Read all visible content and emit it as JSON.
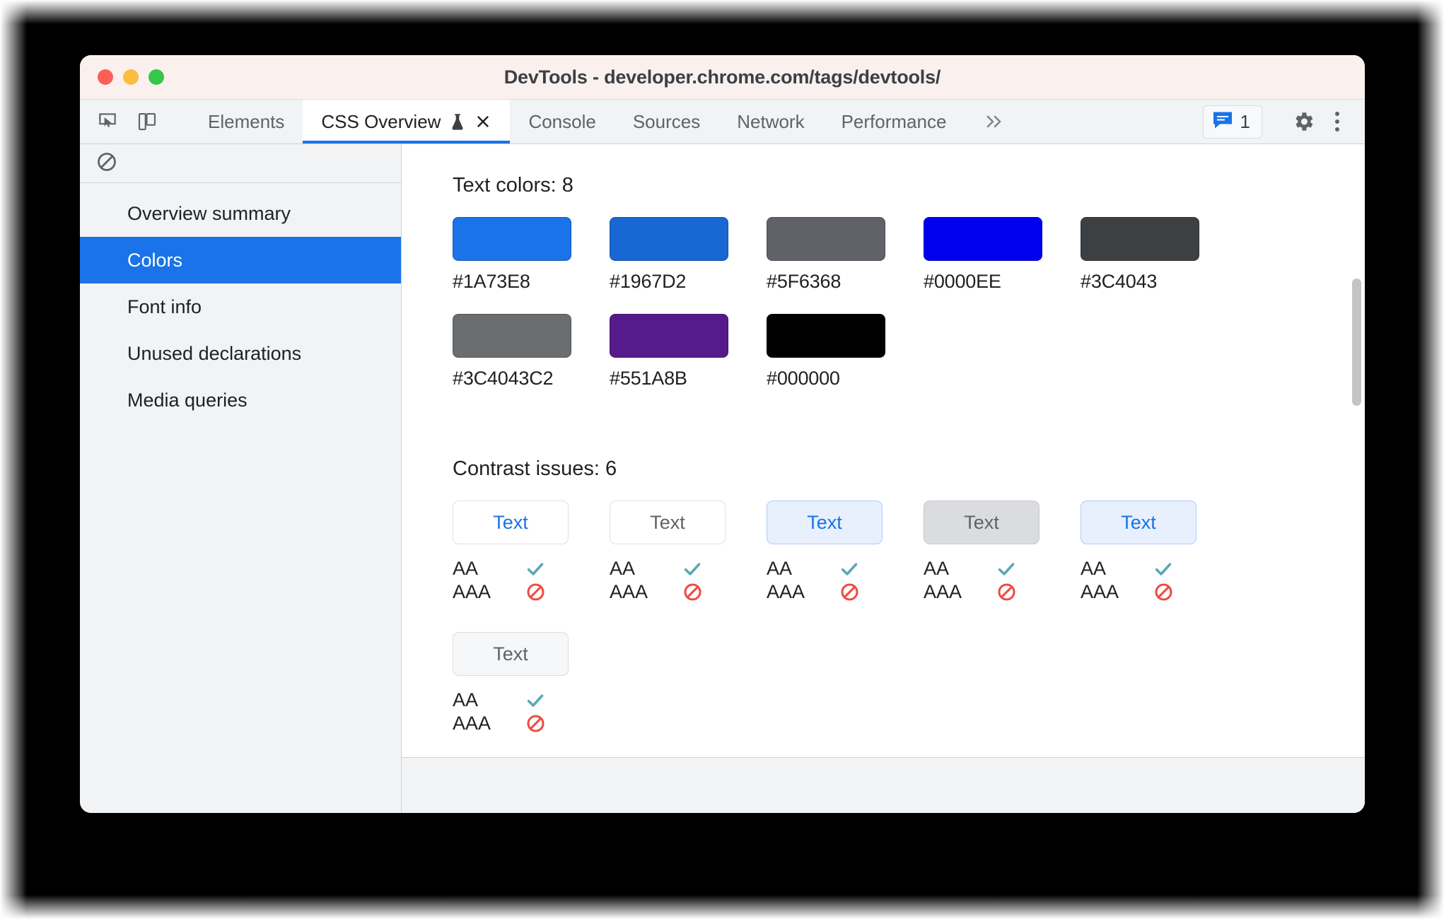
{
  "window": {
    "title": "DevTools - developer.chrome.com/tags/devtools/",
    "traffic_lights": [
      "close",
      "minimize",
      "zoom"
    ]
  },
  "tabstrip": {
    "inspect_icon": "inspect-cursor-icon",
    "device_icon": "device-toolbar-icon",
    "tabs": [
      {
        "label": "Elements",
        "active": false
      },
      {
        "label": "CSS Overview",
        "active": true,
        "experiment": true,
        "closable": true
      },
      {
        "label": "Console",
        "active": false
      },
      {
        "label": "Sources",
        "active": false
      },
      {
        "label": "Network",
        "active": false
      },
      {
        "label": "Performance",
        "active": false
      }
    ],
    "more_tabs_label": "»",
    "message_count": "1",
    "settings_icon": "gear-icon",
    "menu_icon": "kebab-menu-icon"
  },
  "sidebar": {
    "toolbar_icon": "clear-overview-icon",
    "items": [
      {
        "label": "Overview summary",
        "selected": false
      },
      {
        "label": "Colors",
        "selected": true
      },
      {
        "label": "Font info",
        "selected": false
      },
      {
        "label": "Unused declarations",
        "selected": false
      },
      {
        "label": "Media queries",
        "selected": false
      }
    ]
  },
  "content": {
    "text_colors": {
      "heading": "Text colors: 8",
      "swatches": [
        {
          "hex": "#1A73E8",
          "label": "#1A73E8"
        },
        {
          "hex": "#1967D2",
          "label": "#1967D2"
        },
        {
          "hex": "#5F6368",
          "label": "#5F6368"
        },
        {
          "hex": "#0000EE",
          "label": "#0000EE"
        },
        {
          "hex": "#3C4043",
          "label": "#3C4043"
        },
        {
          "hex": "#3C4043C2",
          "label": "#3C4043C2"
        },
        {
          "hex": "#551A8B",
          "label": "#551A8B"
        },
        {
          "hex": "#000000",
          "label": "#000000"
        }
      ]
    },
    "contrast_issues": {
      "heading": "Contrast issues: 6",
      "aa_label": "AA",
      "aaa_label": "AAA",
      "pass_icon": "checkmark-icon",
      "fail_icon": "no-entry-icon",
      "pass_color": "#5BA8B8",
      "fail_color": "#EE4B42",
      "cards": [
        {
          "text": "Text",
          "text_color": "#1A73E8",
          "bg": "#FFFFFF",
          "border": "#E0E0E0",
          "aa": "pass",
          "aaa": "fail"
        },
        {
          "text": "Text",
          "text_color": "#5F6368",
          "bg": "#FFFFFF",
          "border": "#E0E0E0",
          "aa": "pass",
          "aaa": "fail"
        },
        {
          "text": "Text",
          "text_color": "#1A73E8",
          "bg": "#E8F0FE",
          "border": "#AECBFA",
          "aa": "pass",
          "aaa": "fail"
        },
        {
          "text": "Text",
          "text_color": "#5F6368",
          "bg": "#DADCE0",
          "border": "#C6C9CB",
          "aa": "pass",
          "aaa": "fail"
        },
        {
          "text": "Text",
          "text_color": "#1A73E8",
          "bg": "#E8F0FE",
          "border": "#AECBFA",
          "aa": "pass",
          "aaa": "fail"
        },
        {
          "text": "Text",
          "text_color": "#5F6368",
          "bg": "#F5F7F8",
          "border": "#DADCE0",
          "aa": "pass",
          "aaa": "fail"
        }
      ]
    }
  }
}
